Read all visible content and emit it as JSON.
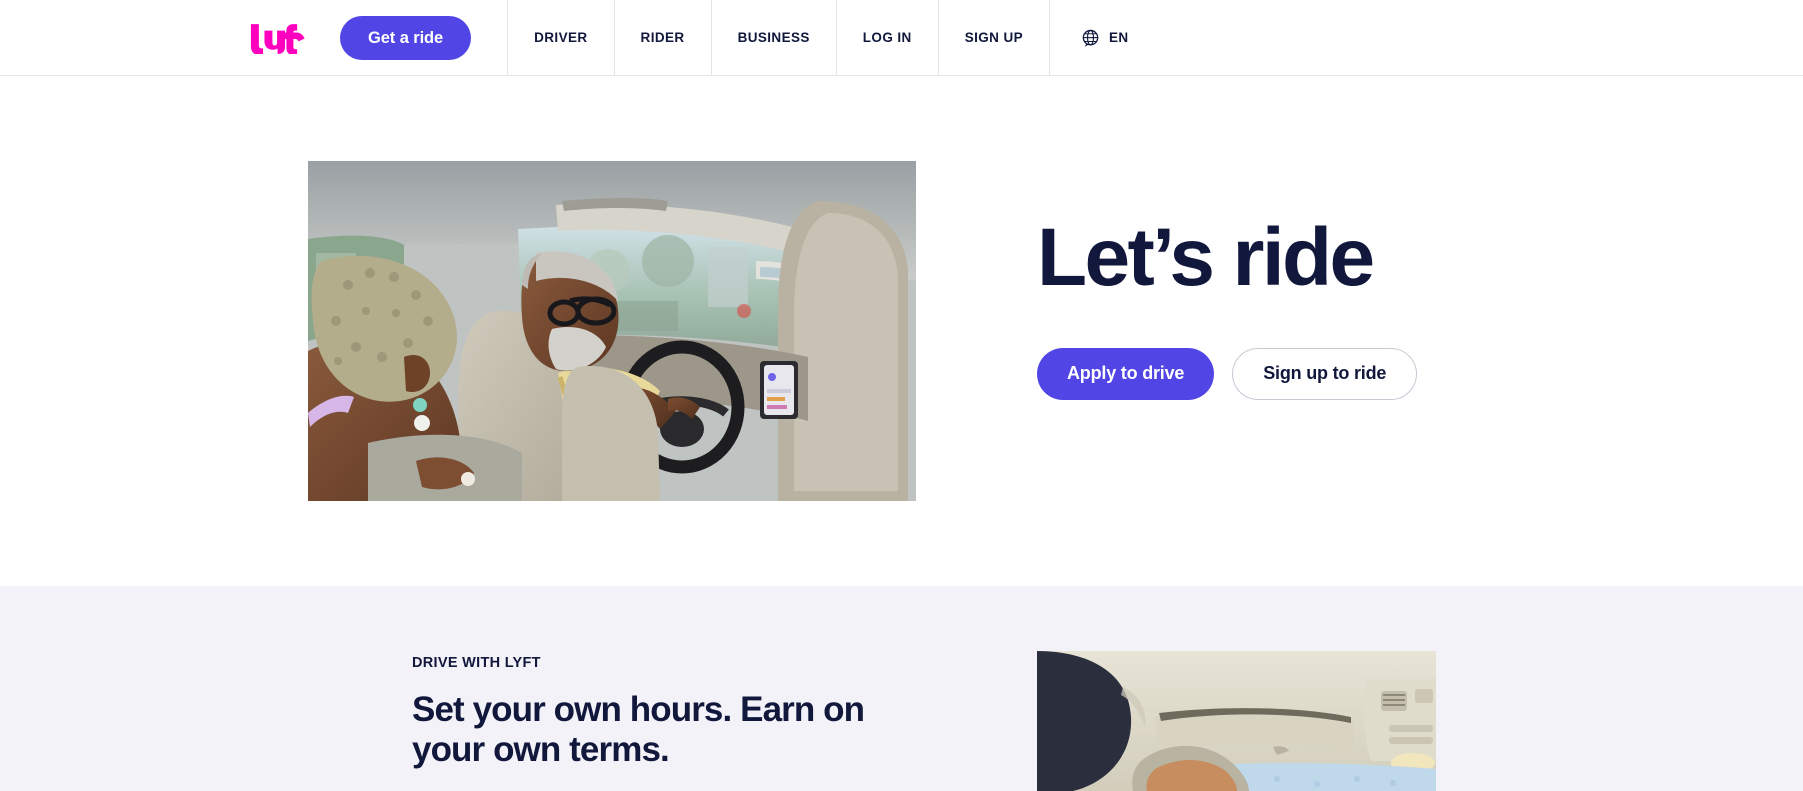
{
  "brand": {
    "logo_name": "lyft-logo",
    "logo_color": "#ff00bf",
    "accent_purple": "#5146e5",
    "text_navy": "#11183c",
    "section_bg": "#f3f2f8",
    "border": "#e4e4ec"
  },
  "header": {
    "cta_label": "Get a ride",
    "nav_items": [
      {
        "label": "DRIVER",
        "name": "nav-item-driver"
      },
      {
        "label": "RIDER",
        "name": "nav-item-rider"
      },
      {
        "label": "BUSINESS",
        "name": "nav-item-business"
      },
      {
        "label": "LOG IN",
        "name": "nav-item-log-in"
      },
      {
        "label": "SIGN UP",
        "name": "nav-item-sign-up"
      }
    ],
    "language": {
      "icon": "globe-icon",
      "label": "EN"
    }
  },
  "hero": {
    "title": "Let’s ride",
    "primary_cta": "Apply to drive",
    "secondary_cta": "Sign up to ride",
    "image_alt": "Rider in back seat and driver at the steering wheel inside a car"
  },
  "drive_section": {
    "eyebrow": "DRIVE WITH LYFT",
    "heading": "Set your own hours. Earn on your own terms.",
    "image_alt": "Interior car headliner with sun visor and a driver's head"
  }
}
